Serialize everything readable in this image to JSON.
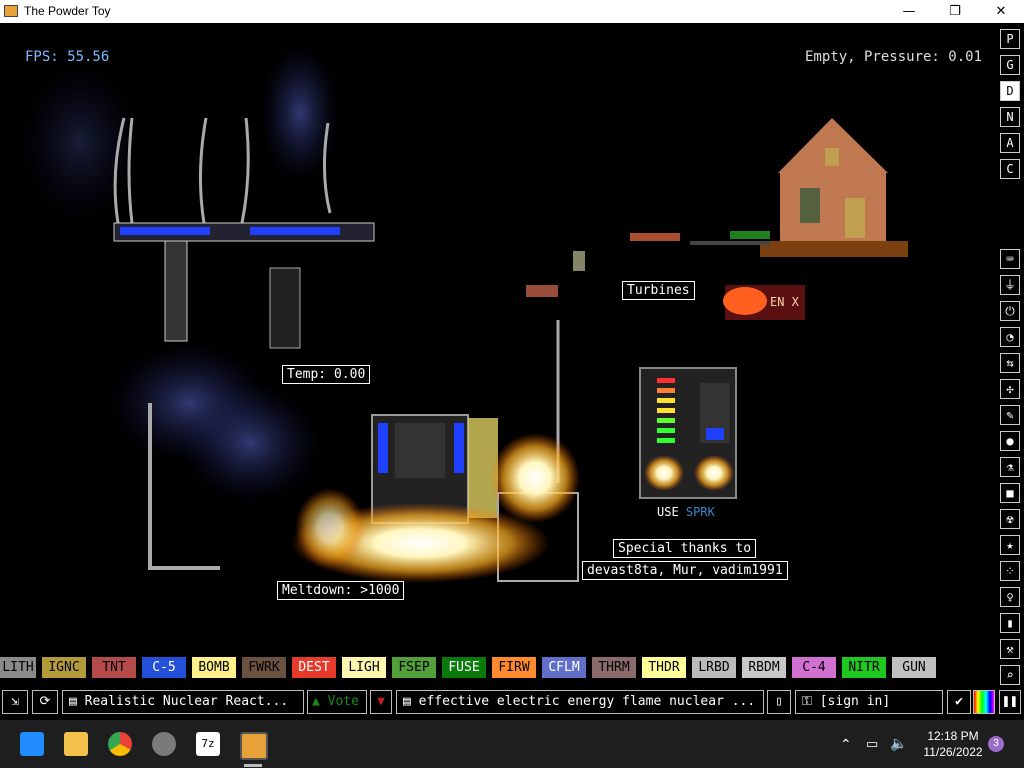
{
  "window": {
    "title": "The Powder Toy",
    "minimize": "—",
    "maximize": "❐",
    "close": "✕"
  },
  "hud": {
    "fps": "FPS: 55.56",
    "status": "Empty, Pressure: 0.01"
  },
  "signs": {
    "turbines": "Turbines",
    "temp": "Temp: 0.00",
    "meltdown": "Meltdown: >1000",
    "thanks1": "Special thanks to",
    "thanks2": "devast8ta, Mur, vadim1991",
    "use": "USE",
    "sprk": "SPRK",
    "enx": "EN X"
  },
  "right_toolbar": {
    "top": [
      "P",
      "G",
      "D",
      "N",
      "A",
      "C"
    ],
    "selected_index": 2,
    "icons": [
      "keyboard-icon",
      "plug-icon",
      "power-icon",
      "gauge-icon",
      "arrows-icon",
      "spray-icon",
      "pen-icon",
      "drop-icon",
      "flask-icon",
      "box-icon",
      "radiation-icon",
      "star-icon",
      "dots-icon",
      "bulb-icon",
      "bookmark-icon",
      "hammer-icon",
      "search-icon"
    ]
  },
  "elements": [
    {
      "label": "LITH",
      "bg": "#8a8a8a",
      "fg": "#000000"
    },
    {
      "label": "IGNC",
      "bg": "#b39b3a",
      "fg": "#000000"
    },
    {
      "label": "TNT",
      "bg": "#b54a4a",
      "fg": "#000000"
    },
    {
      "label": "C-5",
      "bg": "#2250d8",
      "fg": "#ffffff"
    },
    {
      "label": "BOMB",
      "bg": "#fff08a",
      "fg": "#000000"
    },
    {
      "label": "FWRK",
      "bg": "#6b5140",
      "fg": "#000000"
    },
    {
      "label": "DEST",
      "bg": "#e63a2a",
      "fg": "#ffffff"
    },
    {
      "label": "LIGH",
      "bg": "#fff6b0",
      "fg": "#000000"
    },
    {
      "label": "FSEP",
      "bg": "#52a03a",
      "fg": "#000000"
    },
    {
      "label": "FUSE",
      "bg": "#0a7a0a",
      "fg": "#ffffff"
    },
    {
      "label": "FIRW",
      "bg": "#ff8a30",
      "fg": "#000000"
    },
    {
      "label": "CFLM",
      "bg": "#6070c8",
      "fg": "#ffffff"
    },
    {
      "label": "THRM",
      "bg": "#8a6a6a",
      "fg": "#000000"
    },
    {
      "label": "THDR",
      "bg": "#ffff9a",
      "fg": "#000000"
    },
    {
      "label": "LRBD",
      "bg": "#bbbbbb",
      "fg": "#000000"
    },
    {
      "label": "RBDM",
      "bg": "#c8c8c8",
      "fg": "#000000"
    },
    {
      "label": "C-4",
      "bg": "#d070d0",
      "fg": "#000000"
    },
    {
      "label": "NITR",
      "bg": "#1fc81f",
      "fg": "#000000"
    },
    {
      "label": "GUN",
      "bg": "#c0c0c0",
      "fg": "#000000"
    }
  ],
  "bottom_bar": {
    "save_title": "Realistic Nuclear React...",
    "vote": "Vote",
    "tags": "effective electric energy flame nuclear ...",
    "signin": "[sign in]"
  },
  "taskbar": {
    "time": "12:18 PM",
    "date": "11/26/2022",
    "notifications": "3",
    "apps": [
      "windows-start-icon",
      "file-explorer-icon",
      "chrome-icon",
      "settings-gear-icon",
      "7zip-icon",
      "powder-toy-icon"
    ]
  }
}
